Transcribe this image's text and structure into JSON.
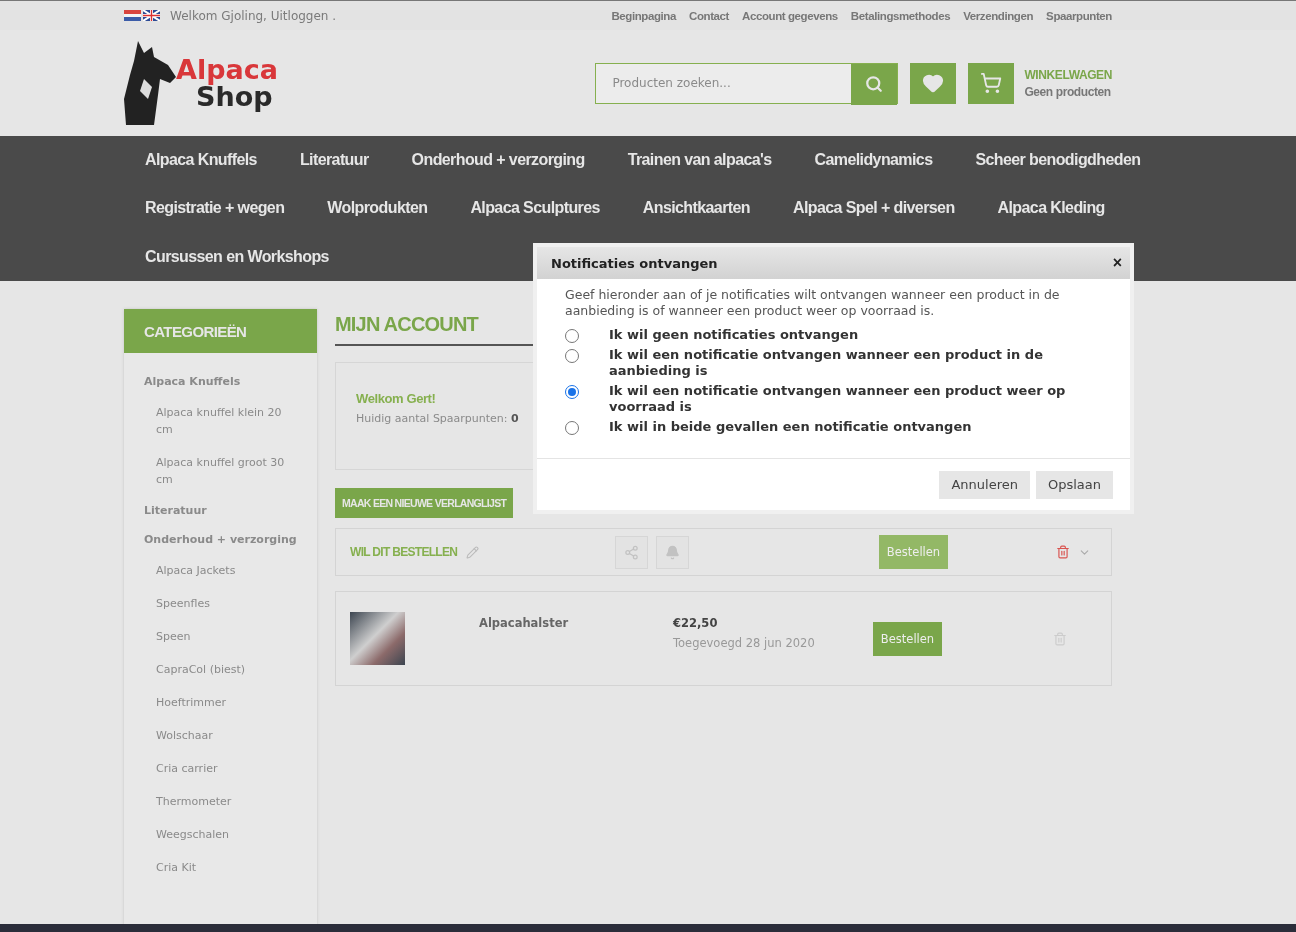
{
  "topbar": {
    "greeting": "Welkom Gjoling, Uitloggen .",
    "links": [
      "Beginpagina",
      "Contact",
      "Account gegevens",
      "Betalingsmethodes",
      "Verzendingen",
      "Spaarpunten"
    ]
  },
  "header": {
    "logo_line1": "Alpaca",
    "logo_line2": "Shop",
    "search": {
      "placeholder": "Producten zoeken..."
    },
    "cart": {
      "title": "WINKELWAGEN",
      "status": "Geen producten"
    }
  },
  "nav_rows": [
    [
      "Alpaca Knuffels",
      "Literatuur",
      "Onderhoud + verzorging",
      "Trainen van alpaca's",
      "Camelidynamics",
      "Scheer benodigdheden"
    ],
    [
      "Registratie + wegen",
      "Wolprodukten",
      "Alpaca Sculptures",
      "Ansichtkaarten",
      "Alpaca Spel + diversen",
      "Alpaca Kleding"
    ],
    [
      "Cursussen en Workshops"
    ]
  ],
  "sidebar": {
    "title": "CATEGORIEËN",
    "items": [
      {
        "label": "Alpaca Knuffels",
        "children": [
          {
            "label": "Alpaca knuffel klein 20 cm"
          },
          {
            "label": "Alpaca knuffel groot 30 cm"
          }
        ]
      },
      {
        "label": "Literatuur"
      },
      {
        "label": "Onderhoud + verzorging",
        "children": [
          {
            "label": "Alpaca Jackets"
          },
          {
            "label": "Speenfles"
          },
          {
            "label": "Speen"
          },
          {
            "label": "CapraCol (biest)"
          },
          {
            "label": "Hoeftrimmer"
          },
          {
            "label": "Wolschaar"
          },
          {
            "label": "Cria carrier"
          },
          {
            "label": "Thermometer"
          },
          {
            "label": "Weegschalen"
          },
          {
            "label": "Cria Kit"
          }
        ]
      }
    ]
  },
  "account": {
    "title": "MIJN ACCOUNT",
    "welcome": "Welkom Gert!",
    "points": "Huidig aantal Spaarpunten: **0**",
    "new_list_button": "MAAK EEN NIEUWE VERLANGLIJST"
  },
  "wishlist": {
    "title": "WIL DIT BESTELLEN",
    "order_button": "Bestellen",
    "items": [
      {
        "name": "Alpacahalster",
        "price": "€22,50",
        "added": "Toegevoegd 28 jun 2020",
        "order_button": "Bestellen"
      }
    ]
  },
  "dialog": {
    "title": "Notificaties ontvangen",
    "close": "×",
    "intro": "Geef hieronder aan of je notificaties wilt ontvangen wanneer een product in de aanbieding is of wanneer een product weer op voorraad is.",
    "options": [
      {
        "label": "Ik wil geen notificaties ontvangen",
        "selected": false
      },
      {
        "label": "Ik wil een notificatie ontvangen wanneer een product in de aanbieding is",
        "selected": false
      },
      {
        "label": "Ik wil een notificatie ontvangen wanneer een product weer op voorraad is",
        "selected": true
      },
      {
        "label": "Ik wil in beide gevallen een notificatie ontvangen",
        "selected": false
      }
    ],
    "buttons": [
      "Annuleren",
      "Opslaan"
    ]
  }
}
